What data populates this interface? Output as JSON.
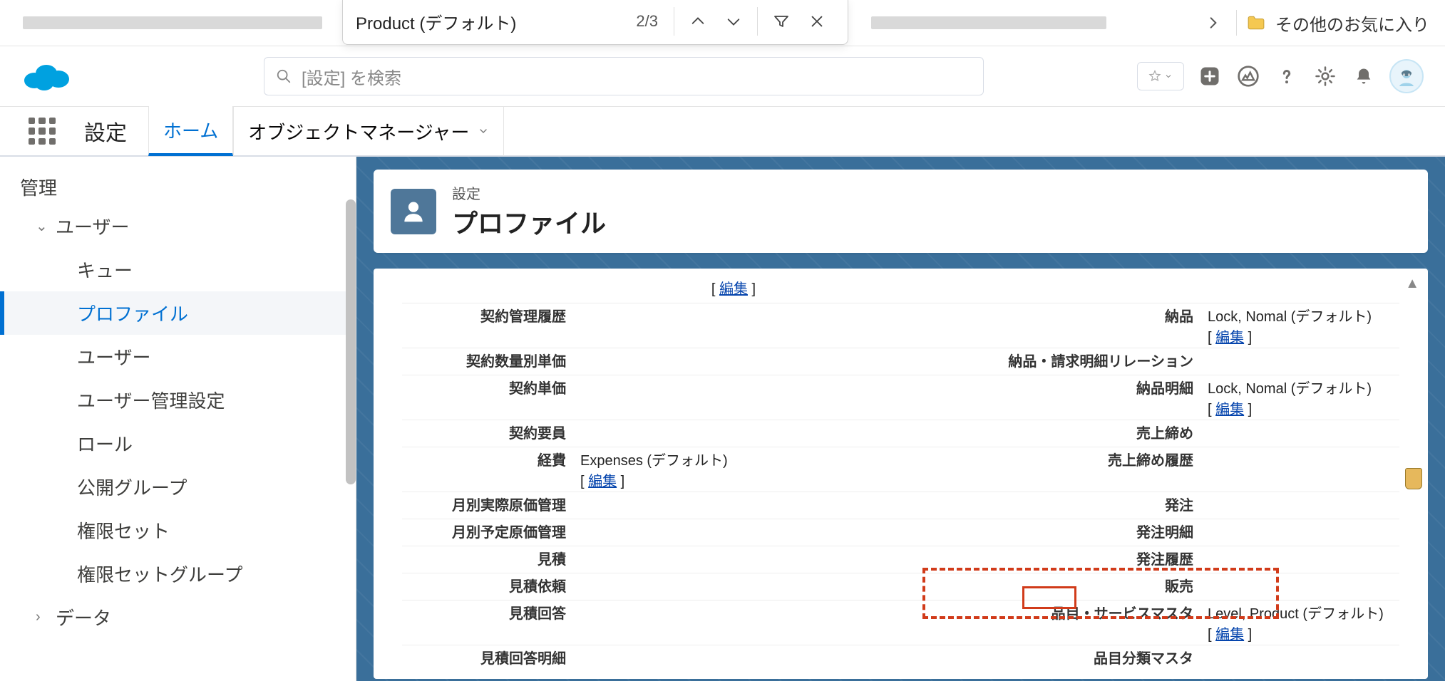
{
  "browser": {
    "find_text": "Product (デフォルト)",
    "find_count": "2/3",
    "favorites_label": "その他のお気に入り"
  },
  "header": {
    "search_placeholder": "[設定] を検索"
  },
  "setup_nav": {
    "label": "設定",
    "tab_home": "ホーム",
    "tab_obj": "オブジェクトマネージャー"
  },
  "sidebar": {
    "section": "管理",
    "user": "ユーザー",
    "items": [
      "キュー",
      "プロファイル",
      "ユーザー",
      "ユーザー管理設定",
      "ロール",
      "公開グループ",
      "権限セット",
      "権限セットグループ"
    ],
    "data": "データ"
  },
  "title": {
    "crumb": "設定",
    "heading": "プロファイル"
  },
  "links": {
    "edit": "編集"
  },
  "rows": {
    "r0": {
      "val_l_pre": "[ ",
      "val_l_link": "編集",
      "val_l_post": " ]"
    },
    "r1": {
      "lbl_l": "契約管理履歴",
      "lbl_r": "納品",
      "val_r": "Lock, Nomal (デフォルト)"
    },
    "r2": {
      "lbl_l": "契約数量別単価",
      "lbl_r": "納品・請求明細リレーション"
    },
    "r3": {
      "lbl_l": "契約単価",
      "lbl_r": "納品明細",
      "val_r": "Lock, Nomal (デフォルト)"
    },
    "r4": {
      "lbl_l": "契約要員",
      "lbl_r": "売上締め"
    },
    "r5": {
      "lbl_l": "経費",
      "val_l": "Expenses (デフォルト)",
      "lbl_r": "売上締め履歴"
    },
    "r6": {
      "lbl_l": "月別実際原価管理",
      "lbl_r": "発注"
    },
    "r7": {
      "lbl_l": "月別予定原価管理",
      "lbl_r": "発注明細"
    },
    "r8": {
      "lbl_l": "見積",
      "lbl_r": "発注履歴"
    },
    "r9": {
      "lbl_l": "見積依頼",
      "lbl_r": "販売"
    },
    "r10": {
      "lbl_l": "見積回答",
      "lbl_r": "品目・サービスマスタ",
      "val_r": "Level, Product (デフォルト)"
    },
    "r11": {
      "lbl_l": "見積回答明細",
      "lbl_r": "品目分類マスタ"
    }
  }
}
